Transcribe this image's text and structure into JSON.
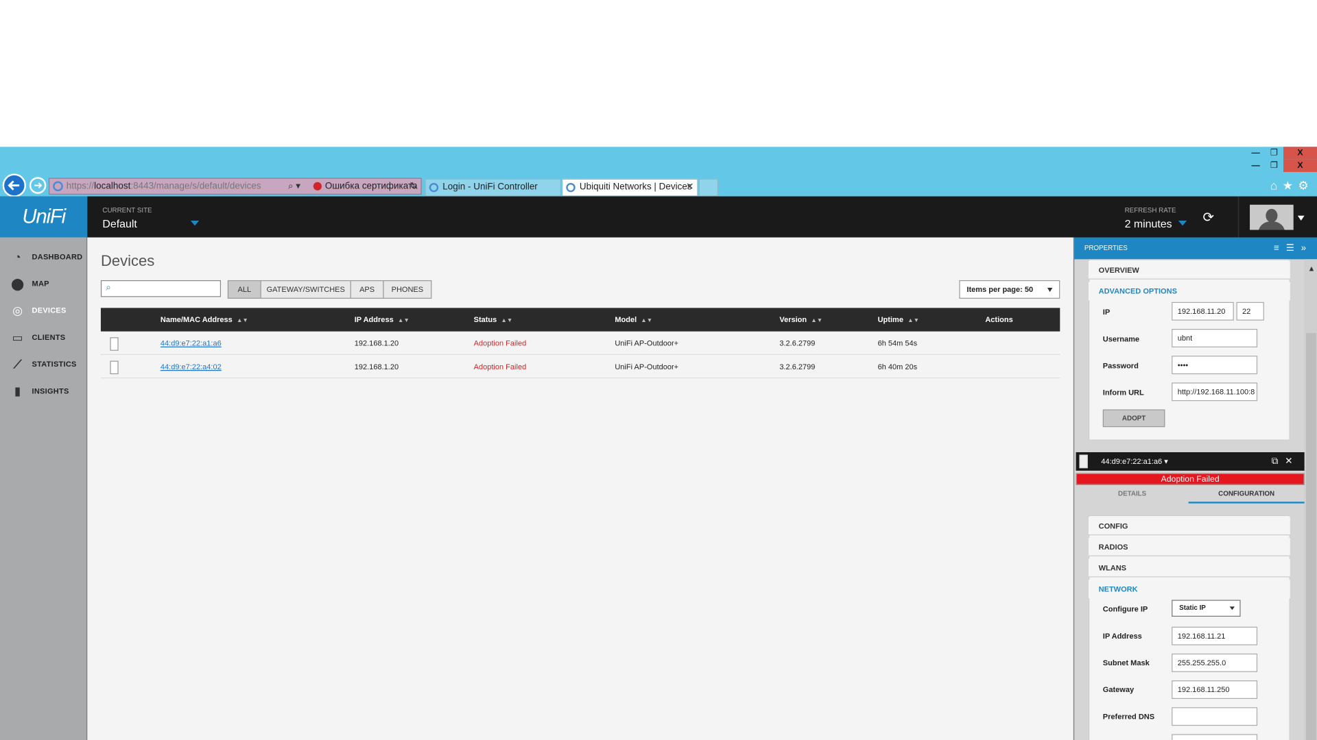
{
  "browser": {
    "url_prefix": "https://",
    "url_host": "localhost",
    "url_path": ":8443/manage/s/default/devices",
    "cert_error": "Ошибка сертификата",
    "tabs": [
      {
        "label": "Login - UniFi Controller"
      },
      {
        "label": "Ubiquiti Networks | Devices"
      }
    ]
  },
  "header": {
    "logo": "UniFi",
    "site_label": "CURRENT SITE",
    "site_value": "Default",
    "refresh_label": "REFRESH RATE",
    "refresh_value": "2 minutes"
  },
  "sidebar": {
    "items": [
      {
        "label": "DASHBOARD",
        "icon": "dashboard-icon"
      },
      {
        "label": "MAP",
        "icon": "map-pin-icon"
      },
      {
        "label": "DEVICES",
        "icon": "devices-icon"
      },
      {
        "label": "CLIENTS",
        "icon": "laptop-icon"
      },
      {
        "label": "STATISTICS",
        "icon": "line-chart-icon"
      },
      {
        "label": "INSIGHTS",
        "icon": "bar-chart-icon"
      }
    ]
  },
  "main": {
    "title": "Devices",
    "filters": [
      "ALL",
      "GATEWAY/SWITCHES",
      "APS",
      "PHONES"
    ],
    "items_per_page": "Items per page: 50",
    "columns": [
      "Name/MAC Address",
      "IP Address",
      "Status",
      "Model",
      "Version",
      "Uptime",
      "Actions"
    ],
    "rows": [
      {
        "name": "44:d9:e7:22:a1:a6",
        "ip": "192.168.1.20",
        "status": "Adoption Failed",
        "model": "UniFi AP-Outdoor+",
        "version": "3.2.6.2799",
        "uptime": "6h 54m 54s"
      },
      {
        "name": "44:d9:e7:22:a4:02",
        "ip": "192.168.1.20",
        "status": "Adoption Failed",
        "model": "UniFi AP-Outdoor+",
        "version": "3.2.6.2799",
        "uptime": "6h 40m 20s"
      }
    ]
  },
  "panel": {
    "title": "PROPERTIES",
    "overview": "OVERVIEW",
    "advanced": "ADVANCED OPTIONS",
    "ip_label": "IP",
    "ip_value": "192.168.11.20",
    "port_value": "22",
    "username_label": "Username",
    "username_value": "ubnt",
    "password_label": "Password",
    "password_value": "••••",
    "inform_label": "Inform URL",
    "inform_value": "http://192.168.11.100:8",
    "adopt_label": "ADOPT",
    "device_name": "44:d9:e7:22:a1:a6",
    "device_status": "Adoption Failed",
    "tab_details": "DETAILS",
    "tab_config": "CONFIGURATION",
    "config": "CONFIG",
    "radios": "RADIOS",
    "wlans": "WLANS",
    "network": "NETWORK",
    "configure_ip_label": "Configure IP",
    "configure_ip_value": "Static IP",
    "ipaddr_label": "IP Address",
    "ipaddr_value": "192.168.11.21",
    "subnet_label": "Subnet Mask",
    "subnet_value": "255.255.255.0",
    "gateway_label": "Gateway",
    "gateway_value": "192.168.11.250",
    "dns_label": "Preferred DNS",
    "dns_value": ""
  }
}
